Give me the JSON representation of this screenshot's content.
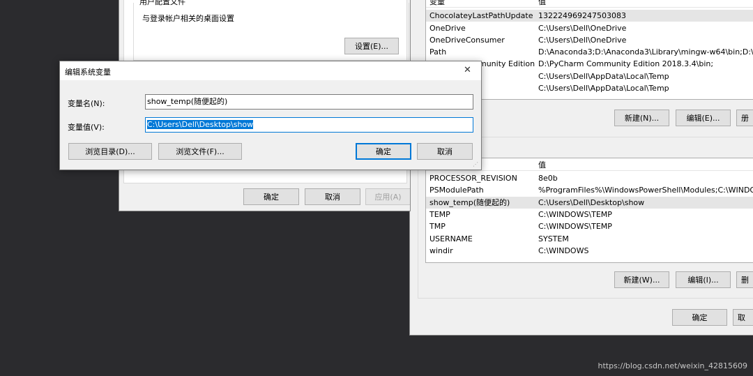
{
  "env_dialog": {
    "user_vars": {
      "header": {
        "name": "变量",
        "value": "值"
      },
      "rows": [
        {
          "name": "ChocolateyLastPathUpdate",
          "value": "132224969247503083"
        },
        {
          "name": "OneDrive",
          "value": "C:\\Users\\Dell\\OneDrive"
        },
        {
          "name": "OneDriveConsumer",
          "value": "C:\\Users\\Dell\\OneDrive"
        },
        {
          "name": "Path",
          "value": "D:\\Anaconda3;D:\\Anaconda3\\Library\\mingw-w64\\bin;D:\\Ar"
        },
        {
          "name": "munity Edition",
          "value": "D:\\PyCharm Community Edition 2018.3.4\\bin;"
        },
        {
          "name": "",
          "value": "C:\\Users\\Dell\\AppData\\Local\\Temp"
        },
        {
          "name": "",
          "value": "C:\\Users\\Dell\\AppData\\Local\\Temp"
        }
      ],
      "buttons": {
        "new": "新建(N)...",
        "edit": "编辑(E)...",
        "delete": "册"
      }
    },
    "system_vars": {
      "header": {
        "name": "",
        "value": "值"
      },
      "rows": [
        {
          "name": "PROCESSOR_REVISION",
          "value": "8e0b"
        },
        {
          "name": "PSModulePath",
          "value": "%ProgramFiles%\\WindowsPowerShell\\Modules;C:\\WINDOW"
        },
        {
          "name": "show_temp(随便起的)",
          "value": "C:\\Users\\Dell\\Desktop\\show"
        },
        {
          "name": "TEMP",
          "value": "C:\\WINDOWS\\TEMP"
        },
        {
          "name": "TMP",
          "value": "C:\\WINDOWS\\TEMP"
        },
        {
          "name": "USERNAME",
          "value": "SYSTEM"
        },
        {
          "name": "windir",
          "value": "C:\\WINDOWS"
        }
      ],
      "buttons": {
        "new": "新建(W)...",
        "edit": "编辑(I)...",
        "delete": "删"
      }
    },
    "ok_label": "确定",
    "cancel_label": "取"
  },
  "sysprop_dialog": {
    "group_title": "用户配置文件",
    "group_desc": "与登录帐户相关的桌面设置",
    "settings_button": "设置(E)...",
    "ok_label": "确定",
    "cancel_label": "取消",
    "apply_label": "应用(A)"
  },
  "edit_dialog": {
    "title": "编辑系统变量",
    "close_glyph": "✕",
    "name_label": "变量名(N):",
    "name_value": "show_temp(随便起的)",
    "value_label": "变量值(V):",
    "value_value": "C:\\Users\\Dell\\Desktop\\show",
    "browse_dir_label": "浏览目录(D)...",
    "browse_file_label": "浏览文件(F)...",
    "ok_label": "确定",
    "cancel_label": "取消"
  },
  "watermark": "https://blog.csdn.net/weixin_42815609"
}
